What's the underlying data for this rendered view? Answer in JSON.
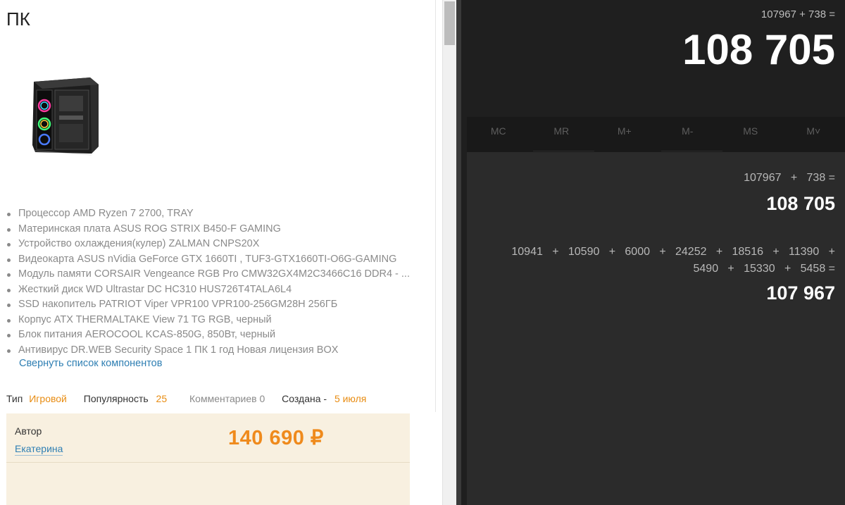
{
  "page": {
    "title": "ПК",
    "components": [
      "Процессор AMD Ryzen 7 2700, TRAY",
      "Материнская плата ASUS ROG STRIX B450-F GAMING",
      "Устройство охлаждения(кулер) ZALMAN CNPS20X",
      "Видеокарта ASUS nVidia GeForce GTX 1660TI , TUF3-GTX1660TI-O6G-GAMING",
      "Модуль памяти CORSAIR Vengeance RGB Pro CMW32GX4M2C3466C16 DDR4 - ...",
      "Жесткий диск WD Ultrastar DC HC310 HUS726T4TALA6L4",
      "SSD накопитель PATRIOT Viper VPR100 VPR100-256GM28H 256ГБ",
      "Корпус ATX THERMALTAKE View 71 TG RGB, черный",
      "Блок питания AEROCOOL KCAS-850G, 850Вт, черный",
      "Антивирус DR.WEB Security Space 1 ПК 1 год Новая лицензия BOX"
    ],
    "collapse_link": "Свернуть список компонентов",
    "meta": {
      "type_label": "Тип",
      "type_value": "Игровой",
      "popularity_label": "Популярность",
      "popularity_value": "25",
      "comments": "Комментариев 0",
      "created_label": "Создана -",
      "created_value": "5 июля"
    },
    "author_label": "Автор",
    "author_name": "Екатерина",
    "price": "140 690 ₽",
    "colors": {
      "accent_orange": "#ef8a1c",
      "link_blue": "#2f7fb3",
      "author_bg": "#f8f0e0"
    }
  },
  "calculator": {
    "top_expression": "107967 + 738 =",
    "display": "108 705",
    "memory_buttons": [
      "MC",
      "MR",
      "M+",
      "M-",
      "MS",
      "M˅"
    ],
    "history": [
      {
        "expression_lines": [
          "107967   +   738 ="
        ],
        "result": "108 705"
      },
      {
        "expression_lines": [
          "10941   +   10590   +   6000   +   24252   +   18516   +   11390   +",
          "5490   +   15330   +   5458 ="
        ],
        "result": "107 967"
      }
    ],
    "colors": {
      "background": "#1f1f1f",
      "history_bg": "#2b2b2b",
      "text": "#ffffff"
    }
  }
}
